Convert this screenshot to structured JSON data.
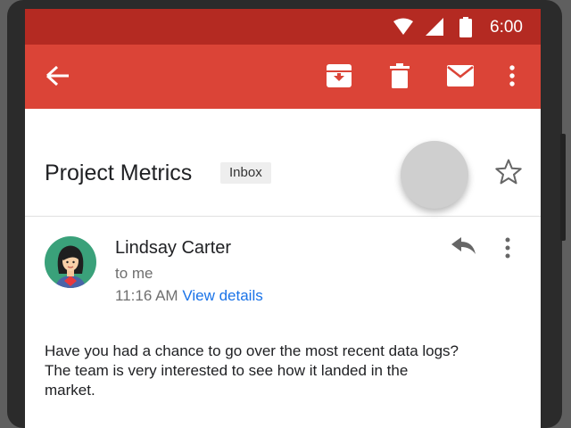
{
  "status_bar": {
    "time": "6:00",
    "icons": [
      "wifi-icon",
      "cellular-icon",
      "battery-icon"
    ]
  },
  "app_bar": {
    "color": "#db4437",
    "status_color": "#b42a22",
    "actions": [
      "back-arrow-icon",
      "archive-icon",
      "delete-icon",
      "mark-unread-icon",
      "overflow-menu-icon"
    ]
  },
  "thread": {
    "subject": "Project Metrics",
    "label": "Inbox"
  },
  "message": {
    "sender": "Lindsay Carter",
    "recipient": "to me",
    "time": "11:16 AM",
    "details_link": "View details",
    "body_line1": "Have you had a chance to go over the most recent data logs?",
    "body_line2": "The team is very interested to see how it landed in the",
    "body_line3": "market."
  }
}
